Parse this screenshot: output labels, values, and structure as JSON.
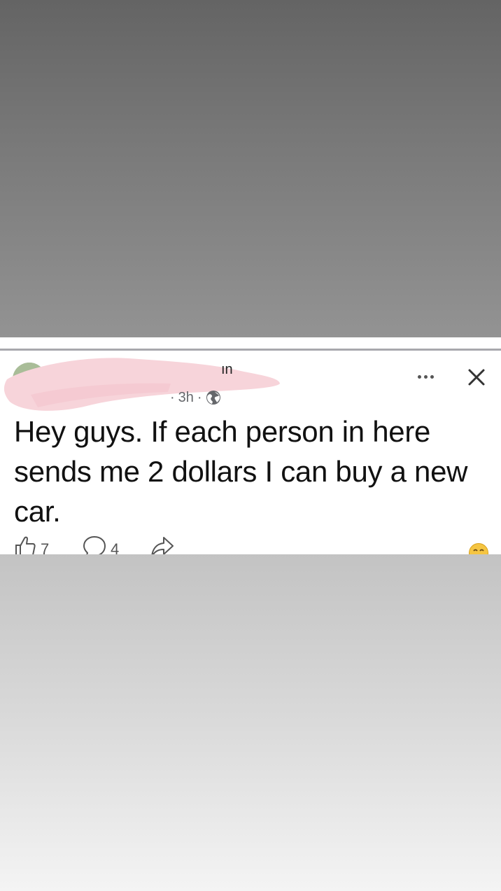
{
  "post": {
    "time": "3h",
    "separator": "·",
    "text": "Hey guys. If each person in here sends me 2 dollars I can buy a new car.",
    "likes": "7",
    "comments": "4"
  },
  "icons": {
    "privacy": "globe-icon",
    "menu": "more-horizontal-icon",
    "close": "close-icon",
    "like": "thumbs-up-icon",
    "comment": "comment-icon",
    "share": "share-icon",
    "reaction": "smiley-emoji-icon"
  },
  "colors": {
    "redaction": "#f7d4da",
    "meta_text": "#65676b",
    "post_text": "#111111"
  }
}
